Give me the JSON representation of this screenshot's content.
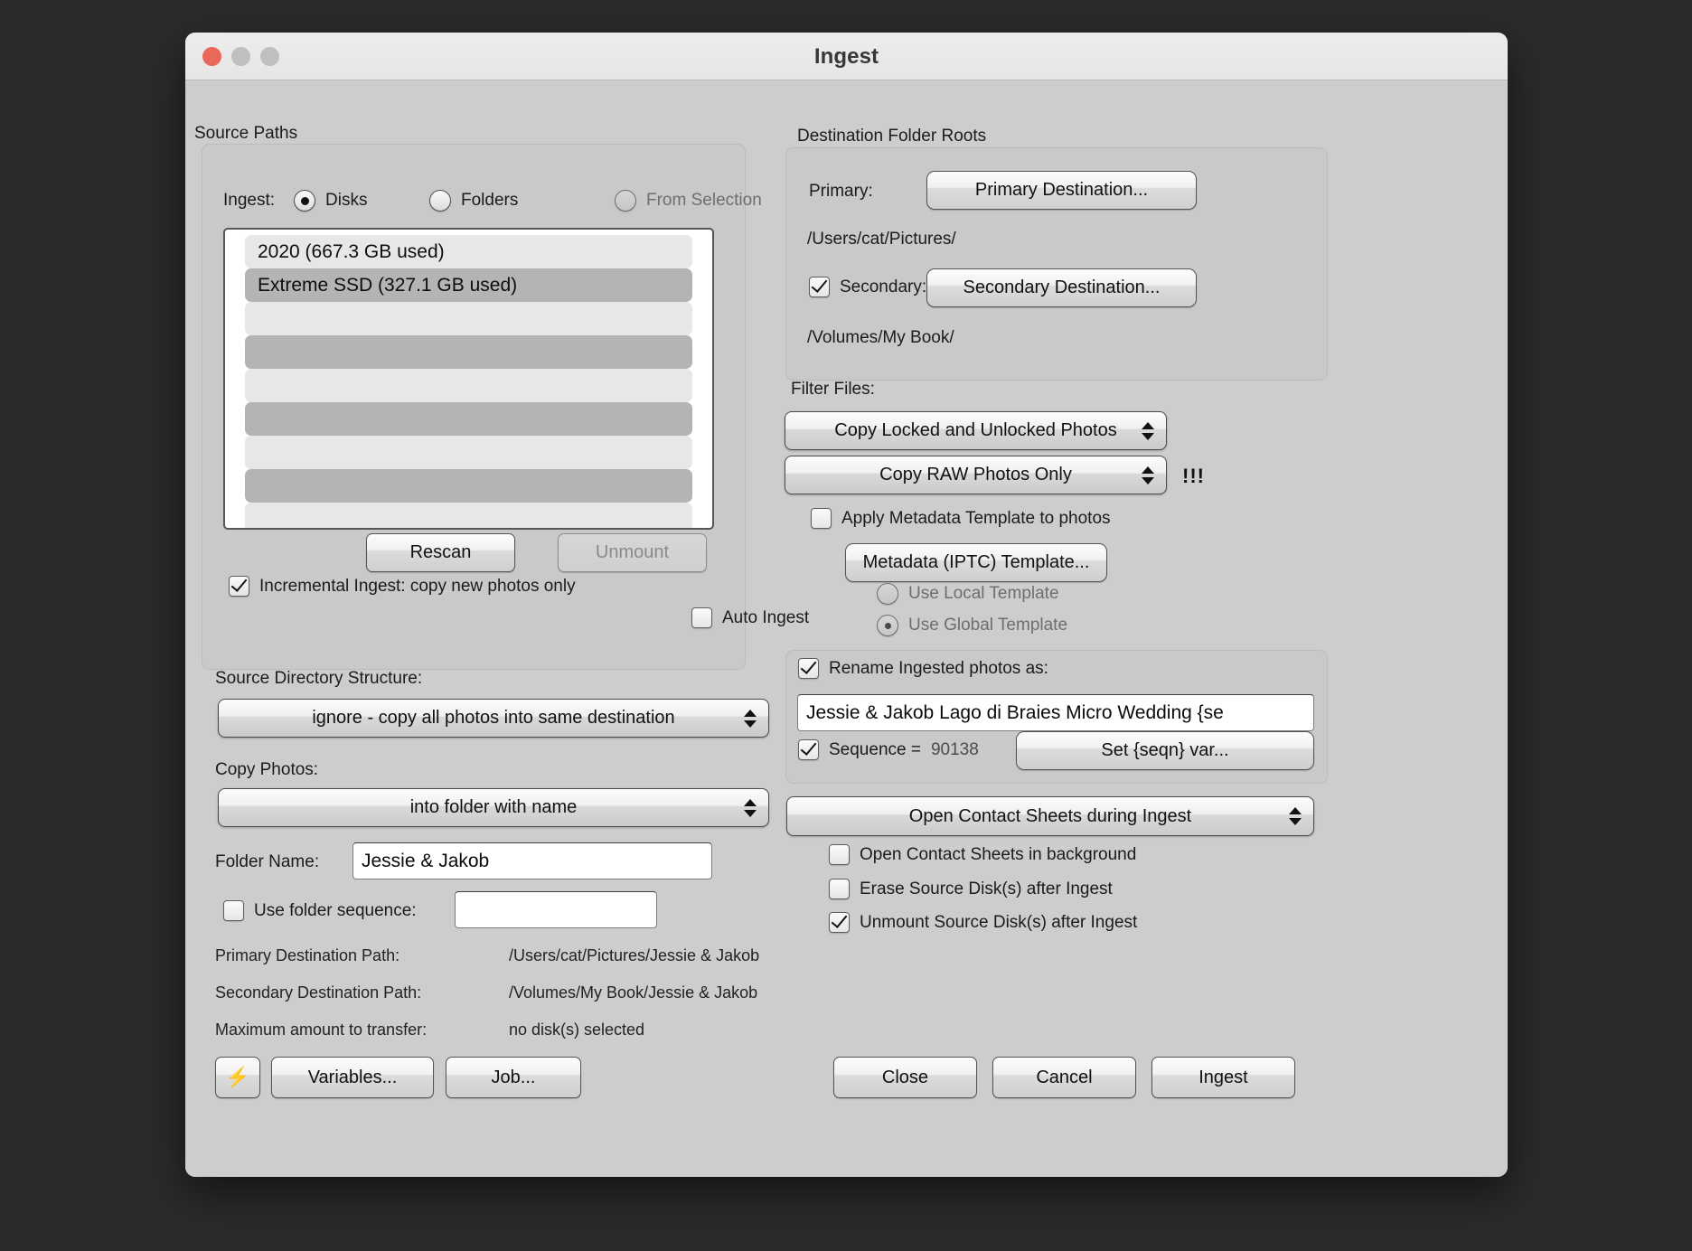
{
  "window": {
    "title": "Ingest",
    "controls": {
      "close": "close-button",
      "minimize": "minimize-button",
      "maximize": "maximize-button"
    }
  },
  "source": {
    "group_label": "Source Paths",
    "ingest_label": "Ingest:",
    "modes": [
      {
        "label": "Disks",
        "selected": true,
        "enabled": true
      },
      {
        "label": "Folders",
        "selected": false,
        "enabled": true
      },
      {
        "label": "From Selection",
        "selected": false,
        "enabled": false
      }
    ],
    "disks": [
      {
        "label": "2020   (667.3 GB used)",
        "selected": false
      },
      {
        "label": "Extreme SSD   (327.1 GB used)",
        "selected": true
      }
    ],
    "empty_row_count": 9,
    "rescan_label": "Rescan",
    "unmount_label": "Unmount",
    "unmount_enabled": false,
    "incremental_label": "Incremental Ingest: copy new photos only",
    "incremental_checked": true,
    "auto_ingest_label": "Auto Ingest",
    "auto_ingest_checked": false
  },
  "structure": {
    "source_dir_label": "Source Directory Structure:",
    "source_dir_value": "ignore - copy all photos into same destination",
    "copy_photos_label": "Copy Photos:",
    "copy_photos_value": "into folder with name",
    "folder_name_label": "Folder Name:",
    "folder_name_value": "Jessie & Jakob",
    "use_folder_sequence_label": "Use folder sequence:",
    "use_folder_sequence_checked": false,
    "folder_sequence_value": ""
  },
  "summary": {
    "rows": [
      {
        "label": "Primary Destination Path:",
        "value": "/Users/cat/Pictures/Jessie & Jakob"
      },
      {
        "label": "Secondary Destination Path:",
        "value": "/Volumes/My Book/Jessie & Jakob"
      },
      {
        "label": "Maximum amount to transfer:",
        "value": "no disk(s) selected"
      }
    ]
  },
  "left_buttons": {
    "bolt_icon": "lightning-bolt-icon",
    "variables_label": "Variables...",
    "job_label": "Job..."
  },
  "destination": {
    "group_label": "Destination Folder Roots",
    "primary_label": "Primary:",
    "primary_button": "Primary Destination...",
    "primary_path": "/Users/cat/Pictures/",
    "secondary_label": "Secondary:",
    "secondary_checked": true,
    "secondary_button": "Secondary Destination...",
    "secondary_path": "/Volumes/My Book/"
  },
  "filter": {
    "group_label": "Filter Files:",
    "lock_filter_value": "Copy Locked and Unlocked Photos",
    "raw_filter_value": "Copy RAW Photos Only",
    "warning_marker": "!!!",
    "apply_metadata_label": "Apply Metadata Template to photos",
    "apply_metadata_checked": false,
    "metadata_button": "Metadata (IPTC) Template...",
    "template_options": [
      {
        "label": "Use Local Template",
        "selected": false
      },
      {
        "label": "Use Global Template",
        "selected": true
      }
    ]
  },
  "rename": {
    "checkbox_label": "Rename Ingested photos as:",
    "checkbox_checked": true,
    "pattern_value": "Jessie & Jakob Lago di Braies Micro Wedding {se",
    "sequence_label": "Sequence =",
    "sequence_checked": true,
    "sequence_value": "90138",
    "set_seqn_button": "Set {seqn} var..."
  },
  "contact": {
    "popup_value": "Open Contact Sheets during Ingest",
    "options": [
      {
        "label": "Open Contact Sheets in background",
        "checked": false
      },
      {
        "label": "Erase Source Disk(s) after Ingest",
        "checked": false
      },
      {
        "label": "Unmount Source Disk(s) after Ingest",
        "checked": true
      }
    ]
  },
  "action_buttons": {
    "close_label": "Close",
    "cancel_label": "Cancel",
    "ingest_label": "Ingest"
  }
}
